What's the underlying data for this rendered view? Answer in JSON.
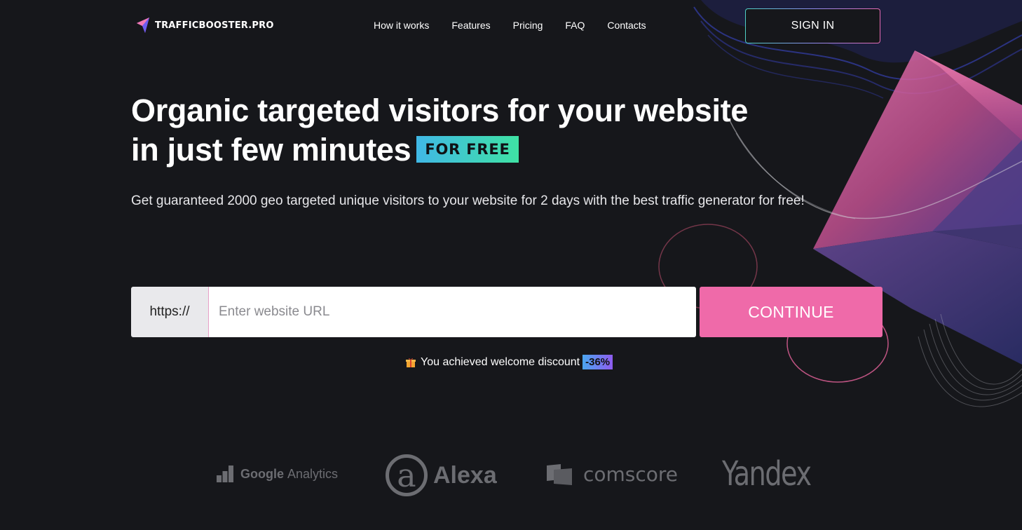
{
  "header": {
    "logo_text": "TRAFFICBOOSTER.PRO",
    "nav": [
      "How it works",
      "Features",
      "Pricing",
      "FAQ",
      "Contacts"
    ],
    "signin_label": "SIGN IN"
  },
  "hero": {
    "headline_line1": "Organic targeted visitors for your website",
    "headline_line2": "in just few minutes",
    "badge": "FOR FREE",
    "subtitle": "Get guaranteed 2000 geo targeted unique visitors to your website for 2 days with the best traffic generator for free!"
  },
  "form": {
    "prefix": "https://",
    "url_placeholder": "Enter website URL",
    "url_value": "",
    "continue_label": "CONTINUE"
  },
  "discount": {
    "text": "You achieved welcome discount",
    "badge": "-36%"
  },
  "partners": {
    "google_analytics_bold": "Google",
    "google_analytics_rest": "Analytics",
    "alexa": "Alexa",
    "alexa_mark": "a",
    "comscore": "comscore",
    "yandex": "Yandex"
  },
  "colors": {
    "background": "#16171b",
    "accent_pink": "#ef6aa9",
    "badge_gradient": [
      "#40b8e6",
      "#3fe2a4"
    ],
    "discount_gradient": [
      "#4aa6f0",
      "#8f5cf0"
    ]
  }
}
